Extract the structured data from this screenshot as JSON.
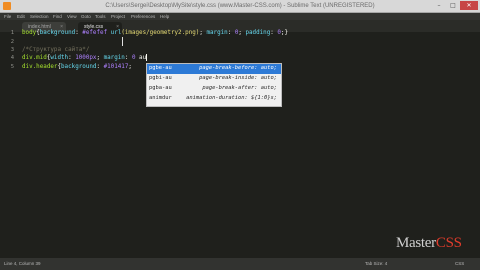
{
  "window": {
    "title": "C:\\Users\\Sergei\\Desktop\\MySite\\style.css (www.Master-CSS.com) - Sublime Text (UNREGISTERED)",
    "minimize": "–",
    "maximize": "□",
    "close": "✕"
  },
  "menu": [
    "File",
    "Edit",
    "Selection",
    "Find",
    "View",
    "Goto",
    "Tools",
    "Project",
    "Preferences",
    "Help"
  ],
  "tabs": [
    {
      "label": "index.html",
      "active": false
    },
    {
      "label": "style.css",
      "active": true
    }
  ],
  "editor": {
    "line_numbers": [
      "1",
      "2",
      "3",
      "4",
      "5"
    ],
    "lines": [
      [
        {
          "t": "body",
          "c": "kw"
        },
        {
          "t": "{",
          "c": ""
        },
        {
          "t": "background",
          "c": "fn"
        },
        {
          "t": ": ",
          "c": ""
        },
        {
          "t": "#efefef",
          "c": "val"
        },
        {
          "t": " ",
          "c": ""
        },
        {
          "t": "url",
          "c": "fn"
        },
        {
          "t": "(images/geometry2.png)",
          "c": "str"
        },
        {
          "t": "; ",
          "c": ""
        },
        {
          "t": "margin",
          "c": "fn"
        },
        {
          "t": ": ",
          "c": ""
        },
        {
          "t": "0",
          "c": "val"
        },
        {
          "t": "; ",
          "c": ""
        },
        {
          "t": "padding",
          "c": "fn"
        },
        {
          "t": ": ",
          "c": ""
        },
        {
          "t": "0",
          "c": "val"
        },
        {
          "t": ";}",
          "c": ""
        }
      ],
      [],
      [
        {
          "t": "/*Структура сайта*/",
          "c": "comment"
        }
      ],
      [
        {
          "t": "div.mid",
          "c": "kw"
        },
        {
          "t": "{",
          "c": ""
        },
        {
          "t": "width",
          "c": "fn"
        },
        {
          "t": ": ",
          "c": ""
        },
        {
          "t": "1000px",
          "c": "val"
        },
        {
          "t": "; ",
          "c": ""
        },
        {
          "t": "margin",
          "c": "fn"
        },
        {
          "t": ": ",
          "c": ""
        },
        {
          "t": "0",
          "c": "val"
        },
        {
          "t": " au",
          "c": ""
        }
      ],
      [
        {
          "t": "div.header",
          "c": "kw"
        },
        {
          "t": "{",
          "c": ""
        },
        {
          "t": "background",
          "c": "fn"
        },
        {
          "t": ": ",
          "c": ""
        },
        {
          "t": "#101417",
          "c": "val"
        },
        {
          "t": ";",
          "c": ""
        }
      ]
    ]
  },
  "autocomplete": [
    {
      "trigger": "pgbe-au",
      "detail": "page-break-before: auto;",
      "selected": true
    },
    {
      "trigger": "pgbi-au",
      "detail": "page-break-inside: auto;",
      "selected": false
    },
    {
      "trigger": "pgba-au",
      "detail": "page-break-after: auto;",
      "selected": false
    },
    {
      "trigger": "animdur",
      "detail": "animation-duration: ${1:0}s;",
      "selected": false
    }
  ],
  "status": {
    "position": "Line 4, Column 39",
    "tab_size": "Tab Size: 4",
    "syntax": "CSS"
  },
  "watermark": {
    "prefix": "Master",
    "accent": "CSS"
  },
  "colors": {
    "editor_bg": "#1f201c",
    "selector": "#a6e22e",
    "value": "#ae81ff",
    "selection": "#2d7ad6"
  }
}
